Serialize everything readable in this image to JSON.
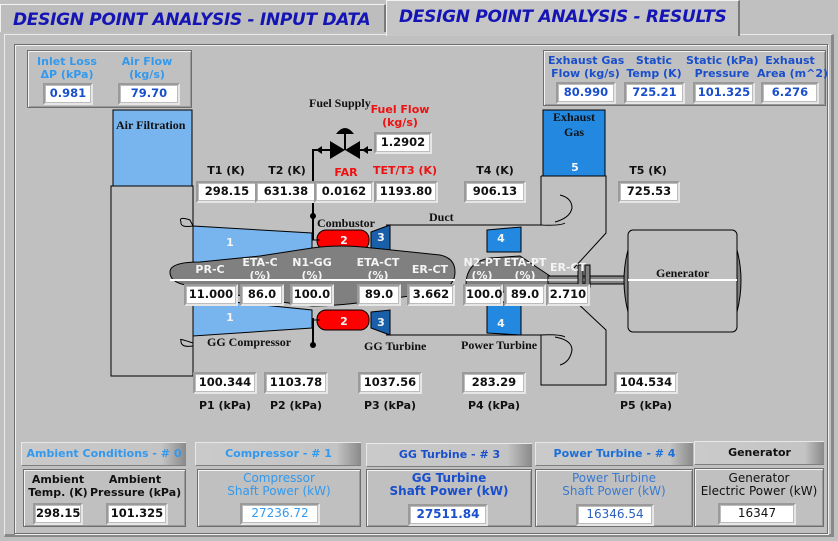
{
  "tabs": [
    {
      "label": "DESIGN POINT ANALYSIS - INPUT DATA",
      "active": false
    },
    {
      "label": "DESIGN POINT ANALYSIS - RESULTS",
      "active": true
    }
  ],
  "inlet": {
    "inlet_loss_label_1": "Inlet Loss",
    "inlet_loss_label_2": "ΔP (kPa)",
    "inlet_loss_value": "0.981",
    "air_flow_label_1": "Air Flow",
    "air_flow_label_2": "(kg/s)",
    "air_flow_value": "79.70"
  },
  "exhaust": {
    "gas_flow_label_1": "Exhaust Gas",
    "gas_flow_label_2": "Flow (kg/s)",
    "gas_flow_value": "80.990",
    "static_temp_label_1": "Static",
    "static_temp_label_2": "Temp (K)",
    "static_temp_value": "725.21",
    "static_pressure_label_1": "Static (kPa)",
    "static_pressure_label_2": "Pressure",
    "static_pressure_value": "101.325",
    "area_label_1": "Exhaust",
    "area_label_2": "Area (m^2)",
    "area_value": "6.276"
  },
  "diagram": {
    "air_filtration": "Air Filtration",
    "fuel_supply": "Fuel Supply",
    "fuel_flow_label_1": "Fuel Flow",
    "fuel_flow_label_2": "(kg/s)",
    "fuel_flow_value": "1.2902",
    "combustor": "Combustor",
    "duct": "Duct",
    "exhaust_gas_1": "Exhaust",
    "exhaust_gas_2": "Gas",
    "gg_compressor": "GG Compressor",
    "gg_turbine": "GG Turbine",
    "power_turbine": "Power Turbine",
    "generator": "Generator",
    "stations": {
      "s1": "1",
      "s2": "2",
      "s3": "3",
      "s4": "4",
      "s5": "5"
    }
  },
  "temperatures": [
    {
      "label": "T1 (K)",
      "value": "298.15"
    },
    {
      "label": "T2 (K)",
      "value": "631.38"
    },
    {
      "label": "FAR",
      "value": "0.0162"
    },
    {
      "label": "TET/T3 (K)",
      "value": "1193.80"
    },
    {
      "label": "T4 (K)",
      "value": "906.13"
    },
    {
      "label": "T5 (K)",
      "value": "725.53"
    }
  ],
  "shaft": [
    {
      "label_1": "PR-C",
      "label_2": "",
      "value": "11.000"
    },
    {
      "label_1": "ETA-C",
      "label_2": "(%)",
      "value": "86.0"
    },
    {
      "label_1": "N1-GG",
      "label_2": "(%)",
      "value": "100.0"
    },
    {
      "label_1": "ETA-CT",
      "label_2": "(%)",
      "value": "89.0"
    },
    {
      "label_1": "ER-CT",
      "label_2": "",
      "value": "3.662"
    },
    {
      "label_1": "N2-PT",
      "label_2": "(%)",
      "value": "100.0"
    },
    {
      "label_1": "ETA-PT",
      "label_2": "(%)",
      "value": "89.0"
    },
    {
      "label_1": "ER-CT",
      "label_2": "",
      "value": "2.710"
    }
  ],
  "pressures": [
    {
      "label": "P1 (kPa)",
      "value": "100.344"
    },
    {
      "label": "P2 (kPa)",
      "value": "1103.78"
    },
    {
      "label": "P3 (kPa)",
      "value": "1037.56"
    },
    {
      "label": "P4 (kPa)",
      "value": "283.29"
    },
    {
      "label": "P5 (kPa)",
      "value": "104.534"
    }
  ],
  "bottom": {
    "ambient": {
      "button": "Ambient Conditions - # 0",
      "temp_label_1": "Ambient",
      "temp_label_2": "Temp. (K)",
      "temp_value": "298.15",
      "pressure_label_1": "Ambient",
      "pressure_label_2": "Pressure (kPa)",
      "pressure_value": "101.325"
    },
    "compressor": {
      "button": "Compressor - # 1",
      "label_1": "Compressor",
      "label_2": "Shaft Power (kW)",
      "value": "27236.72"
    },
    "gg_turbine": {
      "button": "GG Turbine - # 3",
      "label_1": "GG Turbine",
      "label_2": "Shaft Power (kW)",
      "value": "27511.84"
    },
    "power_turbine": {
      "button": "Power Turbine - # 4",
      "label_1": "Power Turbine",
      "label_2": "Shaft Power (kW)",
      "value": "16346.54"
    },
    "generator": {
      "button": "Generator",
      "label_1": "Generator",
      "label_2": "Electric Power (kW)",
      "value": "16347"
    }
  },
  "colors": {
    "tab_text": "#1515b5",
    "light_blue_fill": "#78b4ee",
    "mid_blue_fill": "#2288e0",
    "dark_blue_fill": "#1a5faa",
    "combustor_red": "#ff0000",
    "shaft_gray": "#808080"
  }
}
